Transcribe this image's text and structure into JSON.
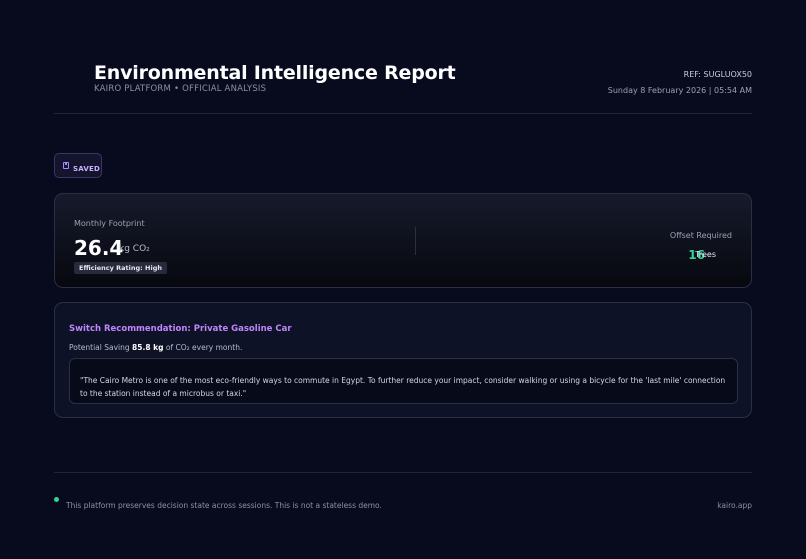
{
  "header": {
    "title": "Environmental Intelligence Report",
    "subtitle": "KAIRO PLATFORM • OFFICIAL ANALYSIS",
    "ref": "REF: SUGLUOX50",
    "datetime": "Sunday 8 February 2026 | 05:54 AM"
  },
  "saved_badge": {
    "icon": "save-icon",
    "label": "SAVED"
  },
  "footprint": {
    "label": "Monthly Footprint",
    "value": "26.4",
    "unit": "kg CO₂",
    "rating": "Efficiency Rating: High",
    "offset_label": "Offset Required",
    "offset_value": "16",
    "offset_unit": "Trees"
  },
  "recommendation": {
    "title": "Switch Recommendation: Private Gasoline Car",
    "saving_prefix": "Potential Saving",
    "saving_amount": "85.8 kg",
    "saving_suffix": "of CO₂ every month.",
    "quote": "\"The Cairo Metro is one of the most eco-friendly ways to commute in Egypt. To further reduce your impact, consider walking or using a bicycle for the 'last mile' connection to the station instead of a microbus or taxi.\""
  },
  "footer": {
    "text": "This platform preserves decision state across sessions. This is not a stateless demo.",
    "link": "kairo.app"
  },
  "colors": {
    "background": "#070b1d",
    "accent_purple": "#c084fc",
    "accent_green": "#34d399"
  }
}
